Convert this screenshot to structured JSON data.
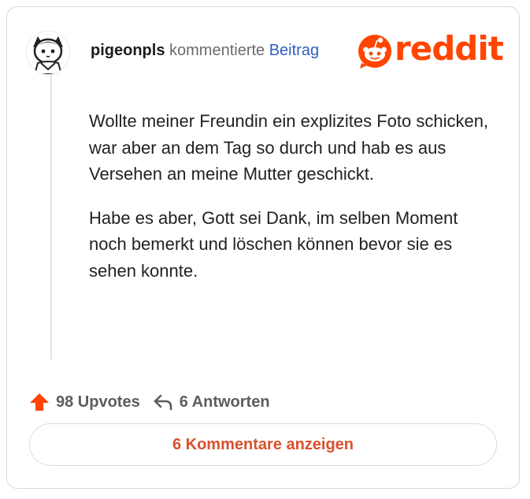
{
  "comment": {
    "username": "pigeonpls",
    "action": " kommentierte ",
    "post_link": "Beitrag",
    "paragraphs": [
      "Wollte meiner Freundin ein explizites Foto schicken, war aber an dem Tag so durch und hab es aus Versehen an meine Mutter geschickt.",
      "Habe es aber, Gott sei Dank, im selben Moment noch bemerkt und löschen können bevor sie es sehen konnte."
    ]
  },
  "brand": {
    "wordmark": "reddit",
    "color": "#ff4500"
  },
  "stats": {
    "upvotes": "98 Upvotes",
    "replies": "6 Antworten",
    "upvote_icon": "upvote-arrow-icon",
    "reply_icon": "reply-arrow-icon",
    "upvote_color": "#ff4500"
  },
  "show_comments_label": "6 Kommentare anzeigen"
}
